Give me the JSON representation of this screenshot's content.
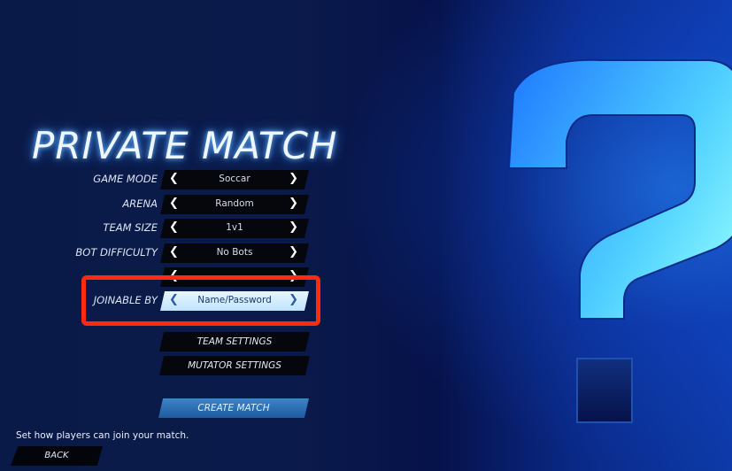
{
  "screen": {
    "title": "PRIVATE MATCH"
  },
  "settings": [
    {
      "label": "GAME MODE",
      "value": "Soccar"
    },
    {
      "label": "ARENA",
      "value": "Random"
    },
    {
      "label": "TEAM SIZE",
      "value": "1v1"
    },
    {
      "label": "BOT DIFFICULTY",
      "value": "No Bots"
    },
    {
      "label": "",
      "value": ""
    },
    {
      "label": "JOINABLE BY",
      "value": "Name/Password"
    }
  ],
  "arrows": {
    "left": "❮",
    "right": "❯"
  },
  "buttons": {
    "team_settings": "TEAM SETTINGS",
    "mutator_settings": "MUTATOR SETTINGS",
    "create_match": "CREATE MATCH",
    "back": "BACK"
  },
  "hint": "Set how players can join your match.",
  "colors": {
    "highlight_box": "#ff2a10",
    "active_selector": "#bfe4ff",
    "create_button": "#2f76b8"
  }
}
